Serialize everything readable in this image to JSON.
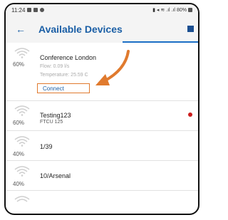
{
  "status_bar": {
    "time": "11:24",
    "right_text": "80%"
  },
  "header": {
    "title": "Available Devices"
  },
  "devices": [
    {
      "name": "Conference London",
      "signal": "60%",
      "flow": "Flow: 0.09 l/s",
      "temperature": "Temperature: 25.59 C",
      "action": "Connect"
    },
    {
      "name": "Testing123",
      "signal": "60%",
      "detail": "FTCU 125",
      "status_color": "#cc1d1d"
    },
    {
      "name": "1/39",
      "signal": "40%"
    },
    {
      "name": "10/Arsenal",
      "signal": "40%"
    }
  ],
  "colors": {
    "accent": "#1b5fa6",
    "highlight": "#e07a2e"
  }
}
